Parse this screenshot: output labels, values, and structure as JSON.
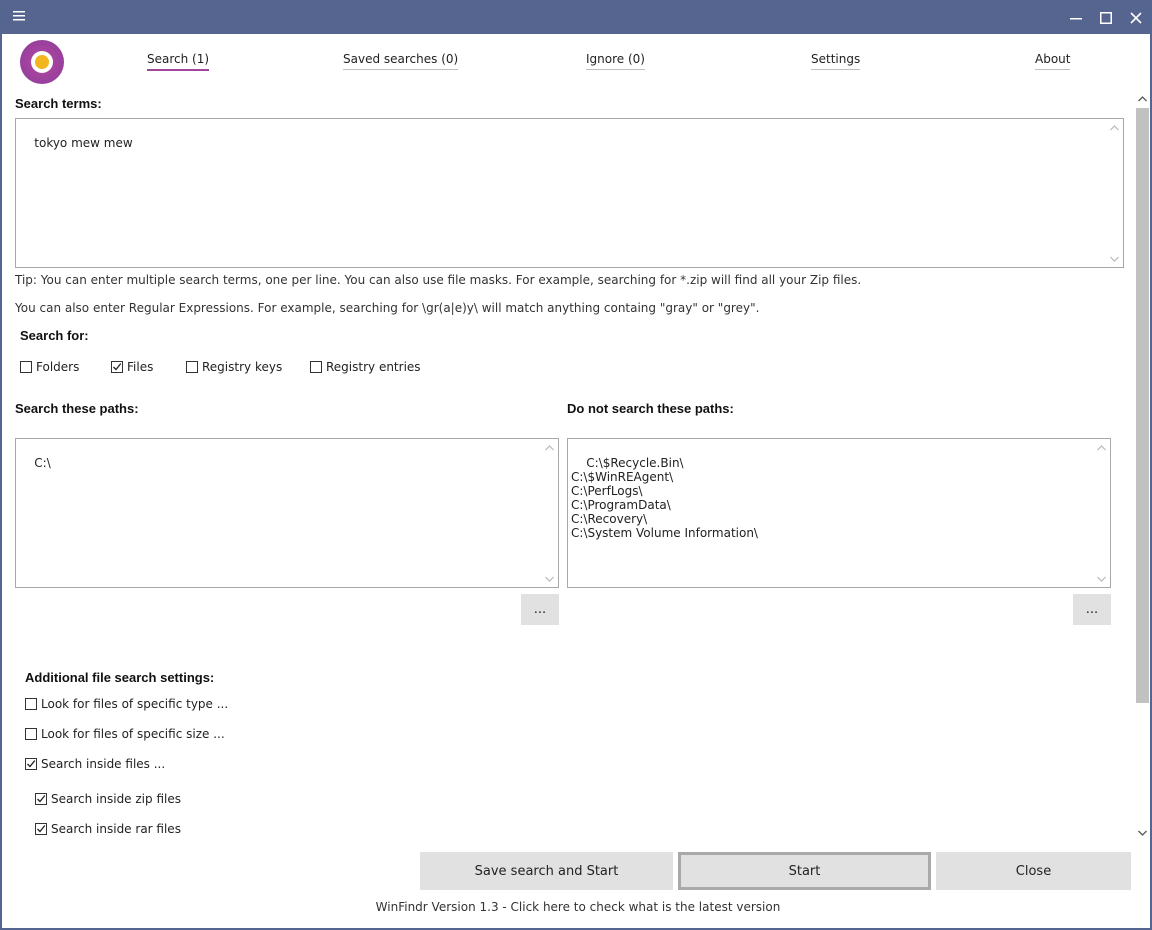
{
  "colors": {
    "titlebar": "#55658f",
    "accent": "#a0479a",
    "logo_ring": "#8c3a9b",
    "logo_core": "#f2b51d"
  },
  "titlebar": {
    "icons": [
      "hamburger-menu-icon",
      "minimize-icon",
      "maximize-icon",
      "close-icon"
    ]
  },
  "nav": {
    "tabs": [
      {
        "label": "Search (1)",
        "active": true
      },
      {
        "label": "Saved searches (0)",
        "active": false
      },
      {
        "label": "Ignore (0)",
        "active": false
      },
      {
        "label": "Settings",
        "active": false
      },
      {
        "label": "About",
        "active": false
      }
    ]
  },
  "search": {
    "terms_label": "Search terms:",
    "terms_value": "tokyo mew mew",
    "tip1": "Tip: You can enter multiple search terms, one per line. You can also use file masks. For example, searching for *.zip will find all your Zip files.",
    "tip2": "You can also enter Regular Expressions. For example, searching for \\gr(a|e)y\\ will match anything containg \"gray\" or \"grey\"."
  },
  "search_for": {
    "label": "Search for:",
    "options": [
      {
        "label": "Folders",
        "checked": false
      },
      {
        "label": "Files",
        "checked": true
      },
      {
        "label": "Registry keys",
        "checked": false
      },
      {
        "label": "Registry entries",
        "checked": false
      }
    ]
  },
  "paths": {
    "include_label": "Search these paths:",
    "include_value": "C:\\",
    "exclude_label": "Do not search these paths:",
    "exclude_value": "C:\\$Recycle.Bin\\\nC:\\$WinREAgent\\\nC:\\PerfLogs\\\nC:\\ProgramData\\\nC:\\Recovery\\\nC:\\System Volume Information\\",
    "browse_label": "..."
  },
  "additional": {
    "label": "Additional file search settings:",
    "options": [
      {
        "label": "Look for files of specific type ...",
        "checked": false
      },
      {
        "label": "Look for files of specific size ...",
        "checked": false
      },
      {
        "label": "Search inside files ...",
        "checked": true
      },
      {
        "label": "Search inside zip files",
        "checked": true
      },
      {
        "label": "Search inside rar files",
        "checked": true
      }
    ]
  },
  "buttons": {
    "save_start": "Save search and Start",
    "start": "Start",
    "close": "Close"
  },
  "footer": {
    "version": "WinFindr Version 1.3 - Click here to check what is the latest version"
  }
}
